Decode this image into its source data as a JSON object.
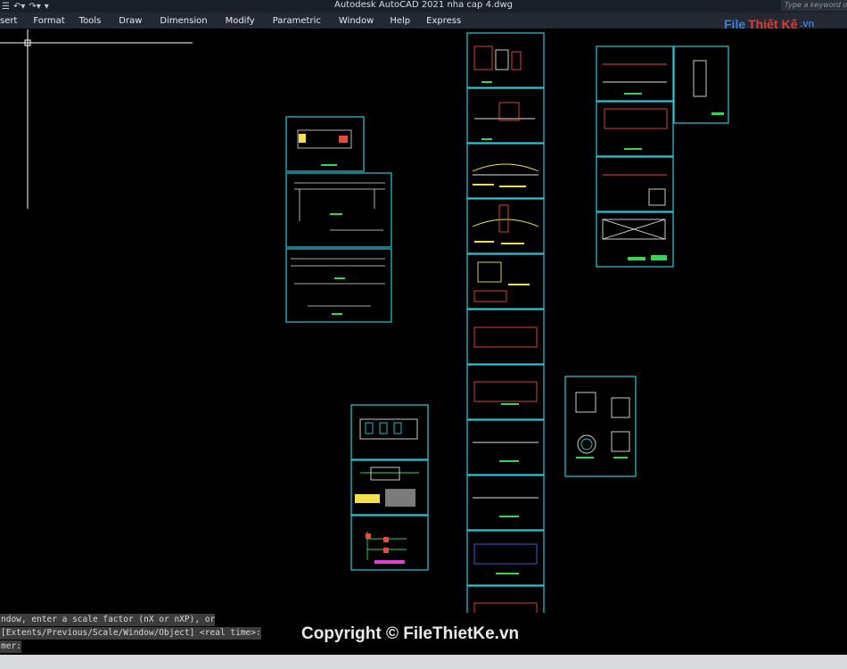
{
  "window": {
    "title": "Autodesk AutoCAD 2021    nha cap 4.dwg",
    "search_placeholder": "Type a keyword or phrase"
  },
  "menu": [
    "sert",
    "Format",
    "Tools",
    "Draw",
    "Dimension",
    "Modify",
    "Parametric",
    "Window",
    "Help",
    "Express"
  ],
  "command_line": [
    "ndow, enter a scale factor (nX or nXP), or",
    "[Extents/Previous/Scale/Window/Object] <real time>:",
    "mer:"
  ],
  "watermark": "Copyright © FileThietKe.vn",
  "logo": {
    "part1": "File",
    "part2": "Thiết Kế",
    "part3": ".vn"
  },
  "colors": {
    "frame": "#2ec7d8",
    "background": "#000000"
  }
}
